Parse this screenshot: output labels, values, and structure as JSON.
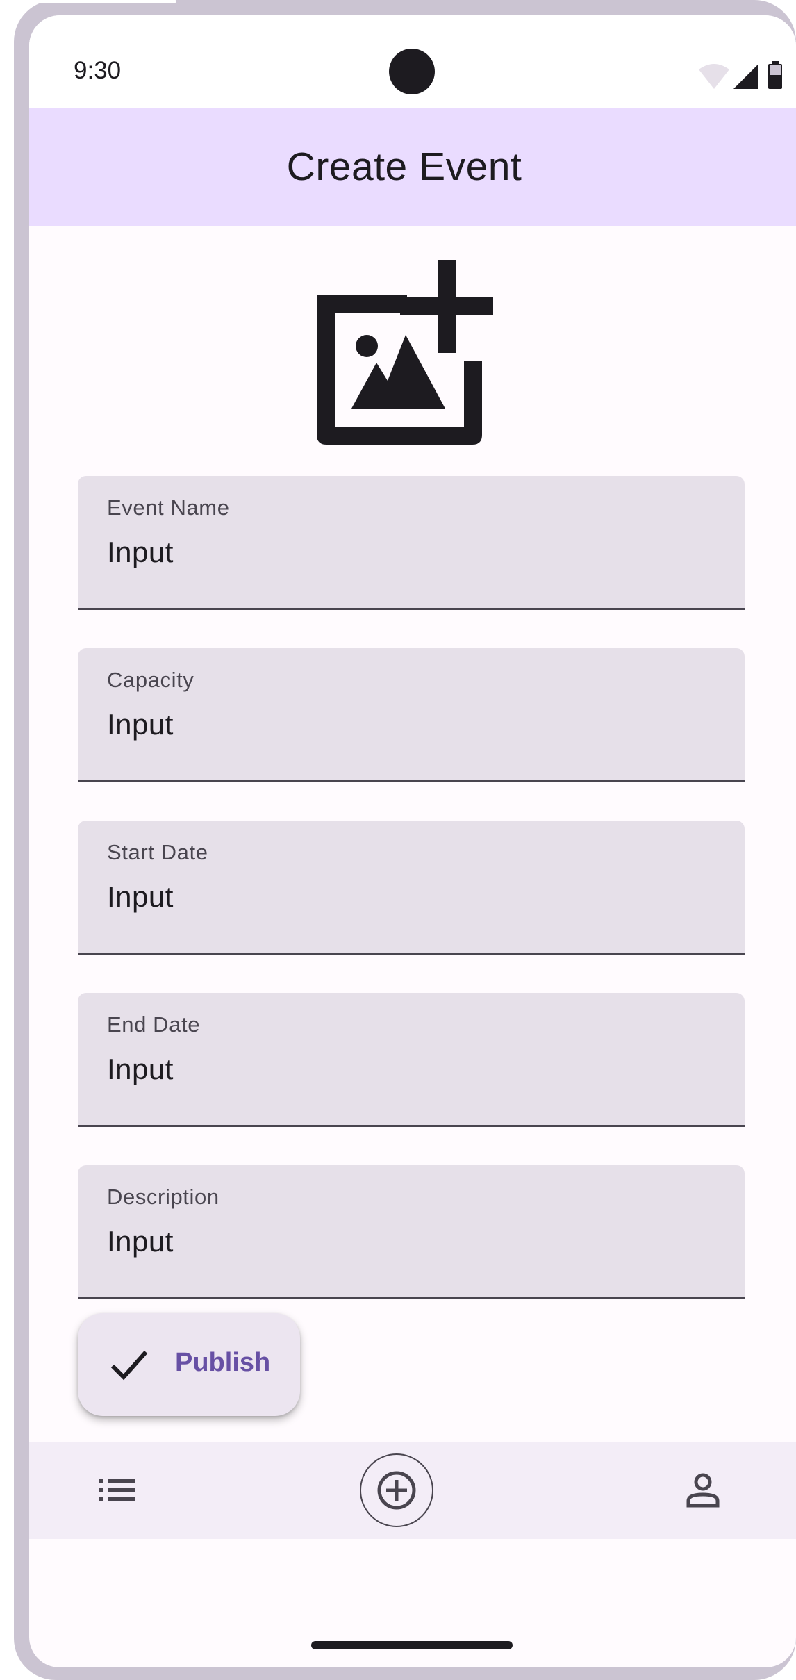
{
  "status_bar": {
    "time": "9:30",
    "icons": [
      "wifi-icon",
      "cell-signal-icon",
      "battery-icon"
    ]
  },
  "app_bar": {
    "title": "Create Event"
  },
  "image_picker": {
    "icon": "add-photo-icon"
  },
  "form": {
    "fields": [
      {
        "label": "Event Name",
        "placeholder": "Input"
      },
      {
        "label": "Capacity",
        "placeholder": "Input"
      },
      {
        "label": "Start Date",
        "placeholder": "Input"
      },
      {
        "label": "End Date",
        "placeholder": "Input"
      },
      {
        "label": "Description",
        "placeholder": "Input"
      }
    ]
  },
  "fab": {
    "icon": "check-icon",
    "label": "Publish"
  },
  "bottom_nav": {
    "items": [
      {
        "icon": "list-icon"
      },
      {
        "icon": "add-circle-icon",
        "selected": true
      },
      {
        "icon": "profile-icon"
      }
    ]
  },
  "colors": {
    "app_bar_bg": "#eadcff",
    "field_bg": "#e6e0e9",
    "primary": "#6750a4",
    "on_surface": "#1d1b20",
    "nav_bg": "#f3edf7"
  }
}
